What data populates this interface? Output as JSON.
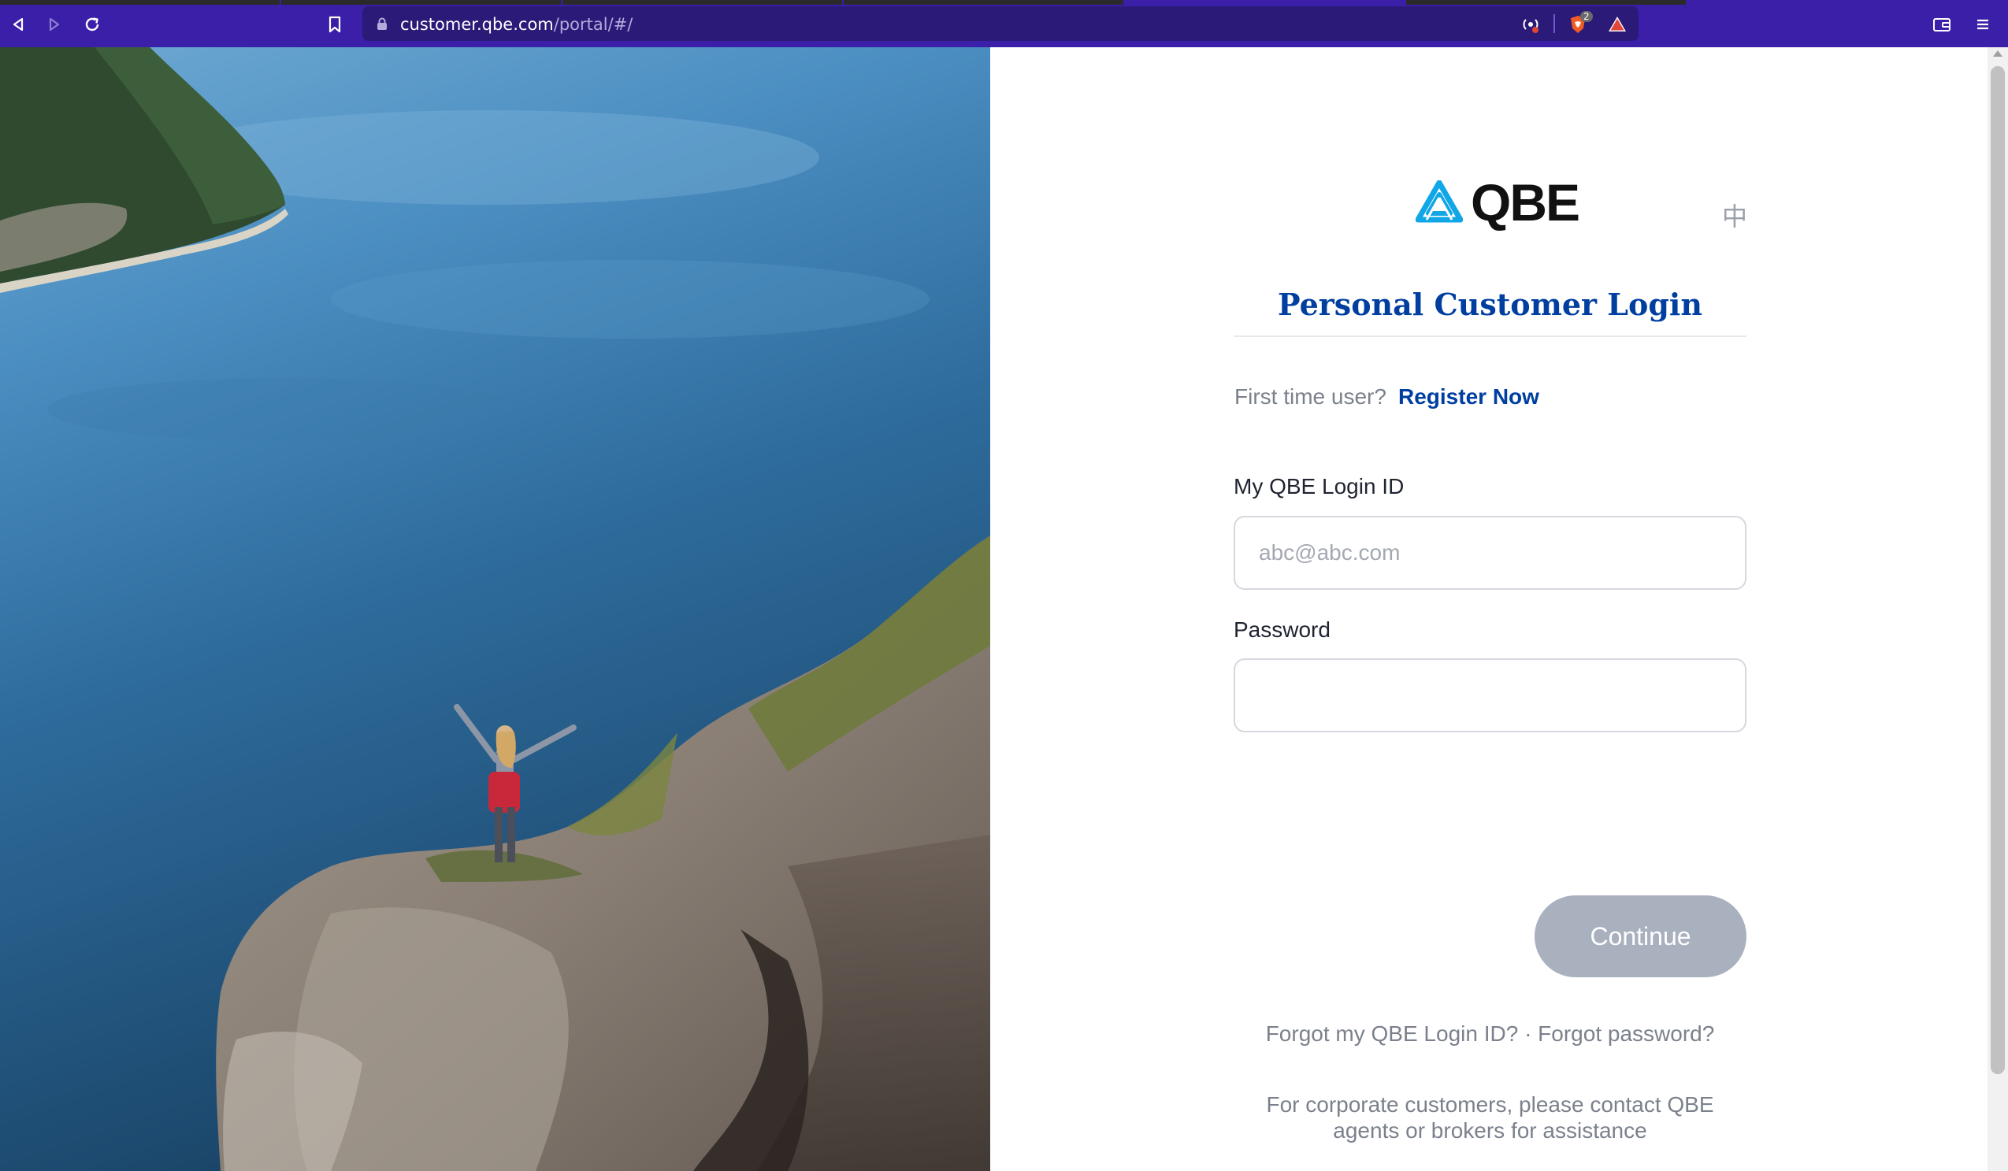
{
  "browser": {
    "url_host": "customer.qbe.com",
    "url_path": "/portal/#/",
    "shield_badge": "2"
  },
  "login": {
    "brand": "QBE",
    "language_toggle": "中",
    "title": "Personal Customer Login",
    "first_time_prompt": "First time user?",
    "register_link": "Register Now",
    "login_id_label": "My QBE Login ID",
    "login_id_placeholder": "abc@abc.com",
    "login_id_value": "",
    "password_label": "Password",
    "password_value": "",
    "continue_label": "Continue",
    "forgot_login_id": "Forgot my QBE Login ID?",
    "separator": "·",
    "forgot_password": "Forgot password?",
    "corporate_note": "For corporate customers, please contact QBE agents or brokers for assistance"
  },
  "colors": {
    "chrome": "#3b1fa8",
    "brand_blue": "#003fa0",
    "logo_cyan": "#11a7e6",
    "button_disabled": "#a9b0be"
  },
  "icons": [
    "back-icon",
    "forward-icon",
    "reload-icon",
    "bookmark-icon",
    "lock-icon",
    "broadcast-icon",
    "brave-shield-icon",
    "brave-rewards-icon",
    "wallet-icon",
    "menu-icon"
  ]
}
